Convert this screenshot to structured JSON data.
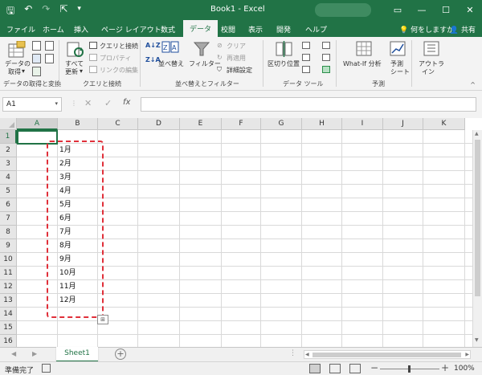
{
  "titlebar": {
    "title": "Book1 - Excel",
    "qat": {
      "save": "🖫",
      "undo": "↶",
      "redo": "↷",
      "touch": "⇱",
      "customize": "▾"
    },
    "window_controls": {
      "ribbon_options": "▭",
      "minimize": "—",
      "maximize": "☐",
      "close": "✕"
    }
  },
  "tabs": [
    "ファイル",
    "ホーム",
    "挿入",
    "ページ レイアウト",
    "数式",
    "データ",
    "校閲",
    "表示",
    "開発",
    "ヘルプ"
  ],
  "active_tab": "データ",
  "tell_me": "何をしますか",
  "share": "共有",
  "ribbon": {
    "get_data": {
      "label1": "データの",
      "label2": "取得",
      "caret": "▾"
    },
    "get_transform_group": "データの取得と変換",
    "refresh_all": {
      "label1": "すべて",
      "label2": "更新",
      "caret": "▾"
    },
    "queries_connections": "クエリと接続",
    "properties": "プロパティ",
    "edit_links": "リンクの編集",
    "queries_group": "クエリと接続",
    "sort_az": "A↓Z",
    "sort_za": "Z↓A",
    "sort": "並べ替え",
    "filter": "フィルター",
    "clear": "クリア",
    "reapply": "再適用",
    "advanced": "詳細設定",
    "sort_filter_group": "並べ替えとフィルター",
    "text_to_columns": "区切り位置",
    "data_tools_group": "データ ツール",
    "what_if": "What-If 分析",
    "forecast1": "予測",
    "forecast2": "シート",
    "forecast_group": "予測",
    "outline1": "アウトラ",
    "outline2": "イン",
    "collapse": "^"
  },
  "formula_bar": {
    "name_box": "A1",
    "cancel": "✕",
    "enter": "✓",
    "fx": "fx",
    "value": ""
  },
  "grid": {
    "columns": [
      "A",
      "B",
      "C",
      "D",
      "E",
      "F",
      "G",
      "H",
      "I",
      "J",
      "K"
    ],
    "rows": [
      "1",
      "2",
      "3",
      "4",
      "5",
      "6",
      "7",
      "8",
      "9",
      "10",
      "11",
      "12",
      "13",
      "14",
      "15",
      "16"
    ],
    "b_values": [
      "1月",
      "2月",
      "3月",
      "4月",
      "5月",
      "6月",
      "7月",
      "8月",
      "9月",
      "10月",
      "11月",
      "12月"
    ],
    "fill_icon": "⊞"
  },
  "sheets": {
    "active": "Sheet1",
    "add": "+",
    "nav_prev": "◀",
    "nav_next": "▶",
    "more": "⋮"
  },
  "status": {
    "ready": "準備完了",
    "zoom": "100%",
    "zoom_minus": "−",
    "zoom_plus": "+"
  },
  "colors": {
    "accent": "#217346",
    "marquee": "#e0303a"
  }
}
